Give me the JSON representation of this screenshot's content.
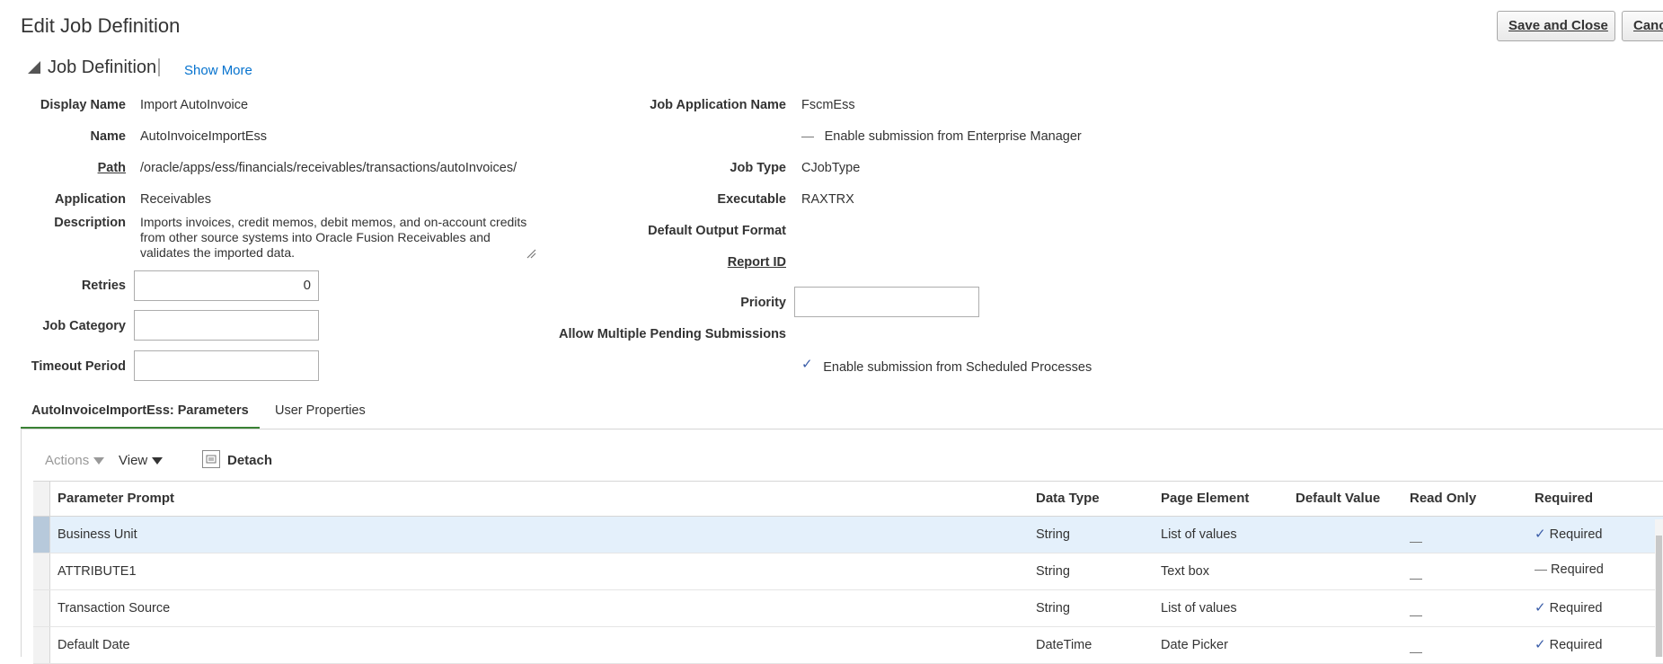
{
  "page": {
    "title": "Edit Job Definition",
    "save_label": "Save and Close",
    "cancel_label": "Canc"
  },
  "section": {
    "title": "Job Definition",
    "show_more": "Show More"
  },
  "left_fields": {
    "display_name_label": "Display Name",
    "display_name": "Import AutoInvoice",
    "name_label": "Name",
    "name": "AutoInvoiceImportEss",
    "path_label": "Path",
    "path": "/oracle/apps/ess/financials/receivables/transactions/autoInvoices/",
    "application_label": "Application",
    "application": "Receivables",
    "description_label": "Description",
    "description": "Imports invoices, credit memos, debit memos, and on-account credits from other source systems into Oracle Fusion Receivables and validates the imported data.",
    "retries_label": "Retries",
    "retries": "0",
    "job_category_label": "Job Category",
    "job_category": "",
    "timeout_period_label": "Timeout Period",
    "timeout_period": ""
  },
  "right_fields": {
    "job_app_name_label": "Job Application Name",
    "job_app_name": "FscmEss",
    "enable_em_label": "Enable submission from Enterprise Manager",
    "job_type_label": "Job Type",
    "job_type": "CJobType",
    "executable_label": "Executable",
    "executable": "RAXTRX",
    "default_output_format_label": "Default Output Format",
    "report_id_label": "Report ID",
    "priority_label": "Priority",
    "priority": "",
    "allow_multiple_label": "Allow Multiple Pending Submissions",
    "enable_scheduled_label": "Enable submission from Scheduled Processes"
  },
  "tabs": {
    "parameters": "AutoInvoiceImportEss: Parameters",
    "user_properties": "User Properties"
  },
  "toolbar": {
    "actions": "Actions",
    "view": "View",
    "detach": "Detach"
  },
  "table": {
    "headers": {
      "prompt": "Parameter Prompt",
      "data_type": "Data Type",
      "page_element": "Page Element",
      "default_value": "Default Value",
      "read_only": "Read Only",
      "required": "Required"
    },
    "rows": [
      {
        "prompt": "Business Unit",
        "data_type": "String",
        "page_element": "List of values",
        "default_value": "",
        "read_only": false,
        "required": true,
        "required_label": "Required"
      },
      {
        "prompt": "ATTRIBUTE1",
        "data_type": "String",
        "page_element": "Text box",
        "default_value": "",
        "read_only": false,
        "required": false,
        "required_label": "Required"
      },
      {
        "prompt": "Transaction Source",
        "data_type": "String",
        "page_element": "List of values",
        "default_value": "",
        "read_only": false,
        "required": true,
        "required_label": "Required"
      },
      {
        "prompt": "Default Date",
        "data_type": "DateTime",
        "page_element": "Date Picker",
        "default_value": "",
        "read_only": false,
        "required": true,
        "required_label": "Required"
      }
    ]
  },
  "colors": {
    "link": "#0572ce",
    "check": "#3a5da8",
    "tab_accent": "#3a8234",
    "selected_row": "#e4f0fb"
  }
}
